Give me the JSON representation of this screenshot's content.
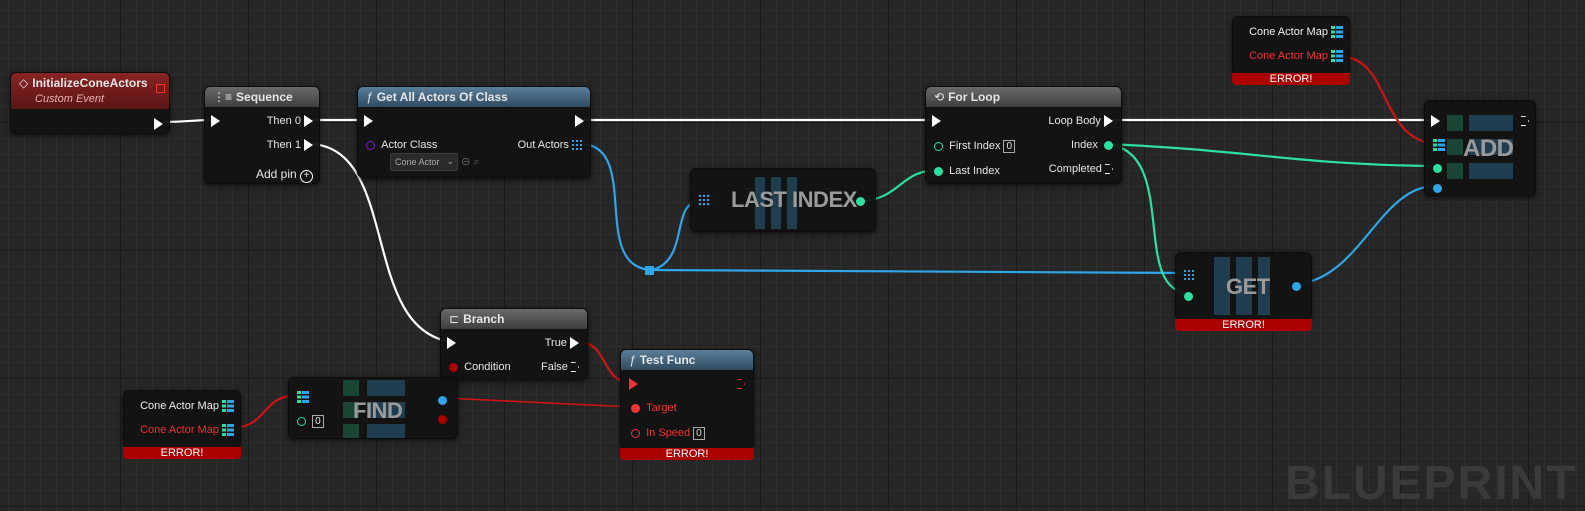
{
  "canvas": {
    "watermark": "BLUEPRINT"
  },
  "nodes": {
    "initialize": {
      "title": "InitializeConeActors",
      "subtitle": "Custom Event"
    },
    "sequence": {
      "title": "Sequence",
      "then0": "Then 0",
      "then1": "Then 1",
      "add_pin": "Add pin"
    },
    "get_all_actors": {
      "title": "Get All Actors Of Class",
      "actor_class_label": "Actor Class",
      "actor_class_value": "Cone Actor",
      "out_actors": "Out Actors"
    },
    "for_loop": {
      "title": "For Loop",
      "first_index": "First Index",
      "first_index_value": "0",
      "last_index": "Last Index",
      "loop_body": "Loop Body",
      "index": "Index",
      "completed": "Completed"
    },
    "last_index": {
      "title": "LAST INDEX"
    },
    "get": {
      "title": "GET",
      "error": "ERROR!"
    },
    "add": {
      "title": "ADD"
    },
    "cone_map_top": {
      "label": "Cone Actor Map",
      "label_error": "Cone Actor Map",
      "error": "ERROR!"
    },
    "branch": {
      "title": "Branch",
      "condition": "Condition",
      "true_label": "True",
      "false_label": "False"
    },
    "test_func": {
      "title": "Test Func",
      "target": "Target",
      "in_speed": "In Speed",
      "in_speed_value": "0",
      "error": "ERROR!"
    },
    "find": {
      "title": "FIND",
      "key_value": "0"
    },
    "cone_map_bottom": {
      "label": "Cone Actor Map",
      "label_error": "Cone Actor Map",
      "error": "ERROR!"
    }
  },
  "colors": {
    "exec": "#ffffff",
    "object": "#2ea6e8",
    "integer": "#2ee0a0",
    "error": "#cc1414",
    "class": "#7a1fc8"
  }
}
